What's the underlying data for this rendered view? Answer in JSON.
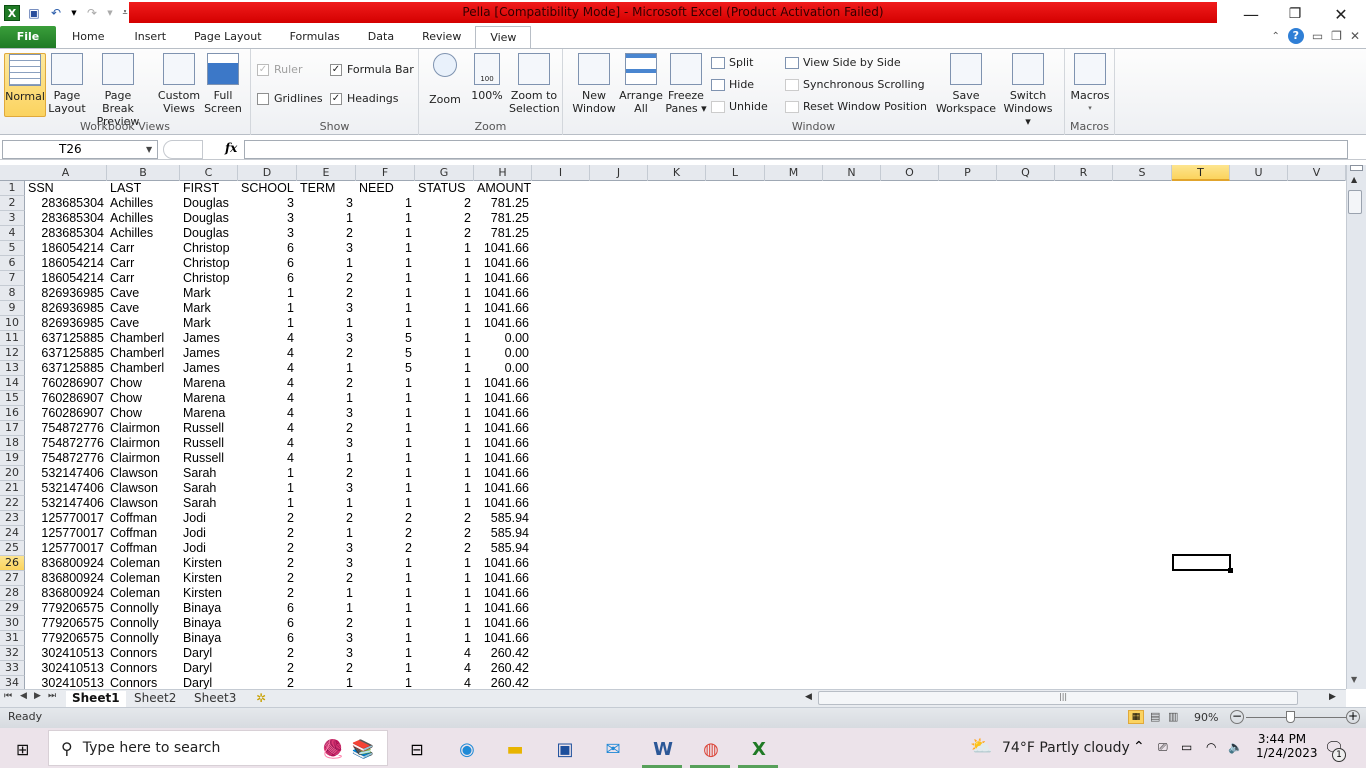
{
  "window": {
    "title": "Pella  [Compatibility Mode]  -  Microsoft Excel (Product Activation Failed)",
    "minimize": "—",
    "restore": "❐",
    "close": "✕"
  },
  "qat": {
    "icons": [
      "excel-logo-icon",
      "save-icon",
      "undo-icon",
      "redo-icon",
      "customize-qat-icon"
    ]
  },
  "tabs": [
    "File",
    "Home",
    "Insert",
    "Page Layout",
    "Formulas",
    "Data",
    "Review",
    "View"
  ],
  "active_tab": "View",
  "ribbon": {
    "workbook_views": {
      "label": "Workbook Views",
      "normal": "Normal",
      "page_layout": [
        "Page",
        "Layout"
      ],
      "page_break": [
        "Page Break",
        "Preview"
      ],
      "custom_views": [
        "Custom",
        "Views"
      ],
      "full_screen": [
        "Full",
        "Screen"
      ]
    },
    "show": {
      "label": "Show",
      "ruler": "Ruler",
      "ruler_checked": true,
      "gridlines": "Gridlines",
      "gridlines_checked": false,
      "formula_bar": "Formula Bar",
      "formula_bar_checked": true,
      "headings": "Headings",
      "headings_checked": true
    },
    "zoom": {
      "label": "Zoom",
      "zoom": "Zoom",
      "hundred": "100%",
      "zoom_sel": [
        "Zoom to",
        "Selection"
      ]
    },
    "window": {
      "label": "Window",
      "new_window": [
        "New",
        "Window"
      ],
      "arrange_all": [
        "Arrange",
        "All"
      ],
      "freeze_panes": [
        "Freeze",
        "Panes ▾"
      ],
      "split": "Split",
      "hide": "Hide",
      "unhide": "Unhide",
      "view_side": "View Side by Side",
      "sync_scroll": "Synchronous Scrolling",
      "reset_pos": "Reset Window Position",
      "save_ws": [
        "Save",
        "Workspace"
      ],
      "switch_win": [
        "Switch",
        "Windows ▾"
      ]
    },
    "macros": {
      "label": "Macros",
      "macros": "Macros",
      "dd": "▾"
    }
  },
  "formula_bar": {
    "name_box": "T26",
    "fx": "fx",
    "formula": ""
  },
  "columns": [
    "A",
    "B",
    "C",
    "D",
    "E",
    "F",
    "G",
    "H",
    "I",
    "J",
    "K",
    "L",
    "M",
    "N",
    "O",
    "P",
    "Q",
    "R",
    "S",
    "T",
    "U",
    "V"
  ],
  "selected_column": "T",
  "selected_row": 26,
  "rows": [
    {
      "n": "1",
      "c": [
        "SSN",
        "LAST",
        "FIRST",
        "SCHOOL",
        "TERM",
        "NEED",
        "STATUS",
        "AMOUNT"
      ],
      "header": true
    },
    {
      "n": "2",
      "c": [
        "283685304",
        "Achilles",
        "Douglas",
        "3",
        "3",
        "1",
        "2",
        "781.25"
      ]
    },
    {
      "n": "3",
      "c": [
        "283685304",
        "Achilles",
        "Douglas",
        "3",
        "1",
        "1",
        "2",
        "781.25"
      ]
    },
    {
      "n": "4",
      "c": [
        "283685304",
        "Achilles",
        "Douglas",
        "3",
        "2",
        "1",
        "2",
        "781.25"
      ]
    },
    {
      "n": "5",
      "c": [
        "186054214",
        "Carr",
        "Christop",
        "6",
        "3",
        "1",
        "1",
        "1041.66"
      ]
    },
    {
      "n": "6",
      "c": [
        "186054214",
        "Carr",
        "Christop",
        "6",
        "1",
        "1",
        "1",
        "1041.66"
      ]
    },
    {
      "n": "7",
      "c": [
        "186054214",
        "Carr",
        "Christop",
        "6",
        "2",
        "1",
        "1",
        "1041.66"
      ]
    },
    {
      "n": "8",
      "c": [
        "826936985",
        "Cave",
        "Mark",
        "1",
        "2",
        "1",
        "1",
        "1041.66"
      ]
    },
    {
      "n": "9",
      "c": [
        "826936985",
        "Cave",
        "Mark",
        "1",
        "3",
        "1",
        "1",
        "1041.66"
      ]
    },
    {
      "n": "10",
      "c": [
        "826936985",
        "Cave",
        "Mark",
        "1",
        "1",
        "1",
        "1",
        "1041.66"
      ]
    },
    {
      "n": "11",
      "c": [
        "637125885",
        "Chamberl",
        "James",
        "4",
        "3",
        "5",
        "1",
        "0.00"
      ]
    },
    {
      "n": "12",
      "c": [
        "637125885",
        "Chamberl",
        "James",
        "4",
        "2",
        "5",
        "1",
        "0.00"
      ]
    },
    {
      "n": "13",
      "c": [
        "637125885",
        "Chamberl",
        "James",
        "4",
        "1",
        "5",
        "1",
        "0.00"
      ]
    },
    {
      "n": "14",
      "c": [
        "760286907",
        "Chow",
        "Marena",
        "4",
        "2",
        "1",
        "1",
        "1041.66"
      ]
    },
    {
      "n": "15",
      "c": [
        "760286907",
        "Chow",
        "Marena",
        "4",
        "1",
        "1",
        "1",
        "1041.66"
      ]
    },
    {
      "n": "16",
      "c": [
        "760286907",
        "Chow",
        "Marena",
        "4",
        "3",
        "1",
        "1",
        "1041.66"
      ]
    },
    {
      "n": "17",
      "c": [
        "754872776",
        "Clairmon",
        "Russell",
        "4",
        "2",
        "1",
        "1",
        "1041.66"
      ]
    },
    {
      "n": "18",
      "c": [
        "754872776",
        "Clairmon",
        "Russell",
        "4",
        "3",
        "1",
        "1",
        "1041.66"
      ]
    },
    {
      "n": "19",
      "c": [
        "754872776",
        "Clairmon",
        "Russell",
        "4",
        "1",
        "1",
        "1",
        "1041.66"
      ]
    },
    {
      "n": "20",
      "c": [
        "532147406",
        "Clawson",
        "Sarah",
        "1",
        "2",
        "1",
        "1",
        "1041.66"
      ]
    },
    {
      "n": "21",
      "c": [
        "532147406",
        "Clawson",
        "Sarah",
        "1",
        "3",
        "1",
        "1",
        "1041.66"
      ]
    },
    {
      "n": "22",
      "c": [
        "532147406",
        "Clawson",
        "Sarah",
        "1",
        "1",
        "1",
        "1",
        "1041.66"
      ]
    },
    {
      "n": "23",
      "c": [
        "125770017",
        "Coffman",
        "Jodi",
        "2",
        "2",
        "2",
        "2",
        "585.94"
      ]
    },
    {
      "n": "24",
      "c": [
        "125770017",
        "Coffman",
        "Jodi",
        "2",
        "1",
        "2",
        "2",
        "585.94"
      ]
    },
    {
      "n": "25",
      "c": [
        "125770017",
        "Coffman",
        "Jodi",
        "2",
        "3",
        "2",
        "2",
        "585.94"
      ]
    },
    {
      "n": "26",
      "c": [
        "836800924",
        "Coleman",
        "Kirsten",
        "2",
        "3",
        "1",
        "1",
        "1041.66"
      ]
    },
    {
      "n": "27",
      "c": [
        "836800924",
        "Coleman",
        "Kirsten",
        "2",
        "2",
        "1",
        "1",
        "1041.66"
      ]
    },
    {
      "n": "28",
      "c": [
        "836800924",
        "Coleman",
        "Kirsten",
        "2",
        "1",
        "1",
        "1",
        "1041.66"
      ]
    },
    {
      "n": "29",
      "c": [
        "779206575",
        "Connolly",
        "Binaya",
        "6",
        "1",
        "1",
        "1",
        "1041.66"
      ]
    },
    {
      "n": "30",
      "c": [
        "779206575",
        "Connolly",
        "Binaya",
        "6",
        "2",
        "1",
        "1",
        "1041.66"
      ]
    },
    {
      "n": "31",
      "c": [
        "779206575",
        "Connolly",
        "Binaya",
        "6",
        "3",
        "1",
        "1",
        "1041.66"
      ]
    },
    {
      "n": "32",
      "c": [
        "302410513",
        "Connors",
        "Daryl",
        "2",
        "3",
        "1",
        "4",
        "260.42"
      ]
    },
    {
      "n": "33",
      "c": [
        "302410513",
        "Connors",
        "Daryl",
        "2",
        "2",
        "1",
        "4",
        "260.42"
      ]
    },
    {
      "n": "34",
      "c": [
        "302410513",
        "Connors",
        "Daryl",
        "2",
        "1",
        "1",
        "4",
        "260.42"
      ]
    }
  ],
  "sheets": [
    "Sheet1",
    "Sheet2",
    "Sheet3"
  ],
  "active_sheet": "Sheet1",
  "status": {
    "ready": "Ready",
    "zoom": "90%"
  },
  "taskbar": {
    "search_placeholder": "Type here to search",
    "weather": "74°F  Partly cloudy",
    "time": "3:44 PM",
    "date": "1/24/2023",
    "notifications": "1"
  }
}
